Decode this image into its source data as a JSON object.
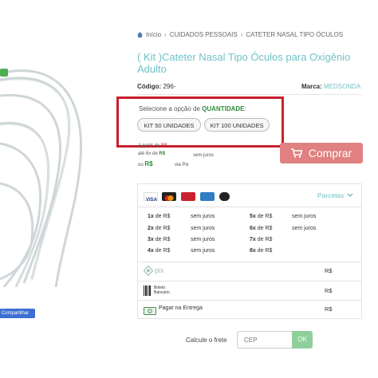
{
  "breadcrumb": {
    "home": "Início",
    "sep": "›",
    "cat": "CUIDADOS PESSOAIS",
    "sub": "CATETER NASAL TIPO ÓCULOS"
  },
  "product": {
    "title": "( Kit )Cateter Nasal Tipo Óculos para Oxigênio Adulto",
    "code_label": "Código:",
    "code_value": "296-",
    "brand_label": "Marca:",
    "brand_value": "MEDSONDA"
  },
  "share": {
    "label": "Compartilhar"
  },
  "options": {
    "label_prefix": "Selecione a opção de ",
    "label_bold": "QUANTIDADE",
    "label_suffix": ":",
    "items": [
      "KIT 50 UNIDADES",
      "KIT 100 UNIDADES"
    ]
  },
  "price": {
    "from": "A partir de",
    "from_val": "R$",
    "installment_prefix": "até 6x de",
    "installment_val": "R$",
    "installment_suffix": "sem juros",
    "or": "ou",
    "pix_val": "R$",
    "pix_suffix": "via Pix"
  },
  "buy": {
    "label": "Comprar",
    "icon": "cart-icon"
  },
  "payments": {
    "parcelas_label": "Parcelas",
    "cards": [
      "visa",
      "mastercard",
      "hipercard",
      "amex",
      "elo"
    ],
    "installments": [
      {
        "n": "1x",
        "de": "de R$",
        "juros": "sem juros"
      },
      {
        "n": "2x",
        "de": "de R$",
        "juros": "sem juros"
      },
      {
        "n": "3x",
        "de": "de R$",
        "juros": "sem juros"
      },
      {
        "n": "4x",
        "de": "de R$",
        "juros": "sem juros"
      },
      {
        "n": "5x",
        "de": "de R$",
        "juros": "sem juros"
      },
      {
        "n": "6x",
        "de": "de R$",
        "juros": "sem juros"
      },
      {
        "n": "7x",
        "de": "de R$",
        "juros": ""
      },
      {
        "n": "8x",
        "de": "de R$",
        "juros": ""
      }
    ],
    "pix_label": "pix",
    "pix_val": "R$",
    "boleto_line1": "Boleto",
    "boleto_line2": "Bancário",
    "boleto_val": "R$",
    "entrega_label": "Pagar na Entrega",
    "entrega_val": "R$"
  },
  "frete": {
    "label": "Calcule o frete",
    "placeholder": "CEP",
    "ok": "OK"
  },
  "colors": {
    "accent": "#6fc2c8",
    "highlight": "#c8202e",
    "buy": "#e08080",
    "ok": "#8fcf9b"
  }
}
